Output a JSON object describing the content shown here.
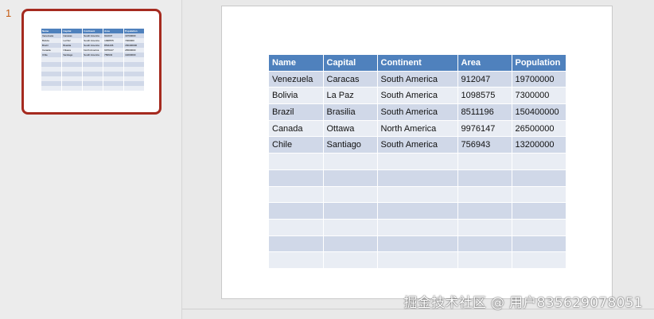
{
  "thumbnail": {
    "slide_number": "1"
  },
  "table": {
    "headers": [
      "Name",
      "Capital",
      "Continent",
      "Area",
      "Population"
    ],
    "rows": [
      [
        "Venezuela",
        "Caracas",
        "South America",
        "912047",
        "19700000"
      ],
      [
        "Bolivia",
        "La Paz",
        "South America",
        "1098575",
        "7300000"
      ],
      [
        "Brazil",
        "Brasilia",
        "South America",
        "8511196",
        "150400000"
      ],
      [
        "Canada",
        "Ottawa",
        "North America",
        "9976147",
        "26500000"
      ],
      [
        "Chile",
        "Santiago",
        "South America",
        "756943",
        "13200000"
      ],
      [
        "",
        "",
        "",
        "",
        ""
      ],
      [
        "",
        "",
        "",
        "",
        ""
      ],
      [
        "",
        "",
        "",
        "",
        ""
      ],
      [
        "",
        "",
        "",
        "",
        ""
      ],
      [
        "",
        "",
        "",
        "",
        ""
      ],
      [
        "",
        "",
        "",
        "",
        ""
      ],
      [
        "",
        "",
        "",
        "",
        ""
      ]
    ]
  },
  "watermark": "掘金技术社区 @ 用户835629078051",
  "colors": {
    "header": "#4f81bd",
    "row_odd": "#d0d8e8",
    "row_even": "#e9edf4",
    "thumb_border": "#a52a1f"
  }
}
